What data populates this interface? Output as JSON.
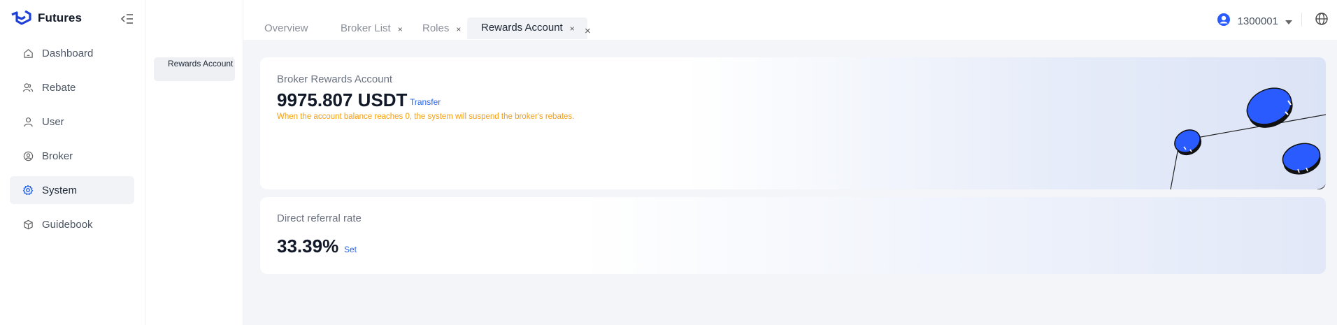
{
  "app": {
    "name": "Futures"
  },
  "sidebar": {
    "items": [
      {
        "label": "Dashboard",
        "icon": "home-icon",
        "active": false
      },
      {
        "label": "Rebate",
        "icon": "users-icon",
        "active": false
      },
      {
        "label": "User",
        "icon": "user-icon",
        "active": false
      },
      {
        "label": "Broker",
        "icon": "user-circle-icon",
        "active": false
      },
      {
        "label": "System",
        "icon": "gear-icon",
        "active": true
      },
      {
        "label": "Guidebook",
        "icon": "cube-icon",
        "active": false
      }
    ]
  },
  "submenu": {
    "items": [
      {
        "label": "Rewards Account",
        "active": true
      }
    ]
  },
  "tabs": [
    {
      "label": "Overview",
      "closable": false
    },
    {
      "label": "Broker List",
      "closable": true
    },
    {
      "label": "Roles",
      "closable": true
    },
    {
      "label": "Rewards Account",
      "closable": true,
      "active": true
    }
  ],
  "tab_close_glyph": "×",
  "user": {
    "id": "1300001"
  },
  "colors": {
    "accent": "#2563eb",
    "warning": "#f59e0b",
    "coin": "#2a5bff"
  },
  "rewards_card": {
    "title": "Broker Rewards Account",
    "balance": "9975.807 USDT",
    "transfer_label": "Transfer",
    "warning": "When the account balance reaches 0, the system will suspend the broker's rebates."
  },
  "referral_card": {
    "title": "Direct referral rate",
    "rate": "33.39%",
    "set_label": "Set"
  }
}
